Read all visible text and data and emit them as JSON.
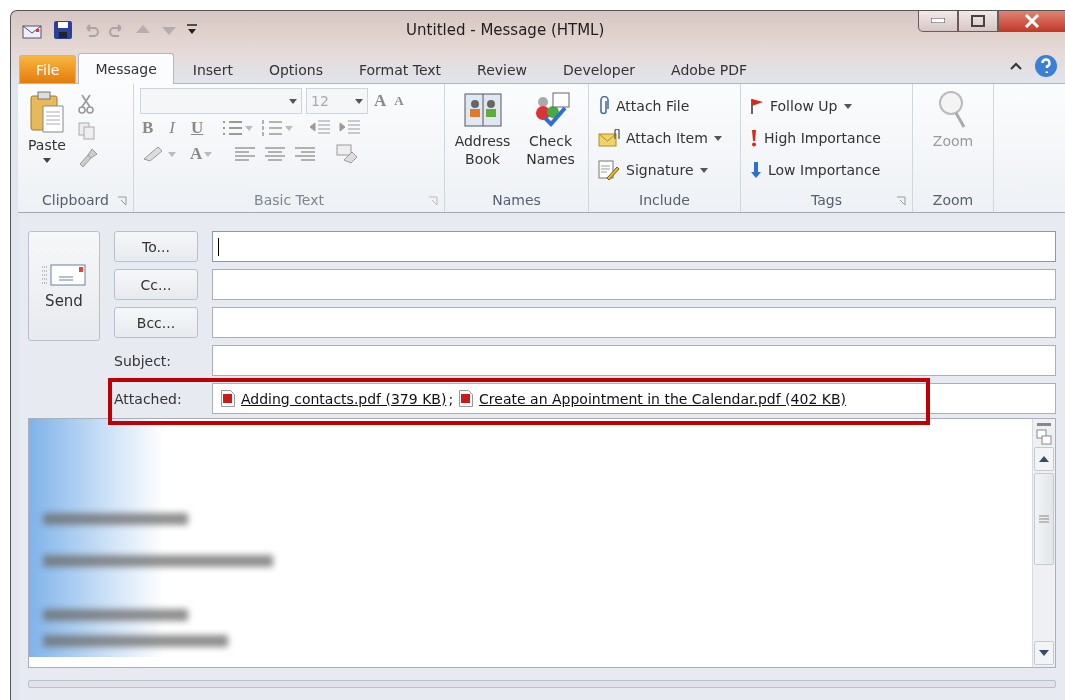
{
  "window": {
    "title": "Untitled  -  Message (HTML)"
  },
  "tabs": [
    {
      "label": "File",
      "kind": "file",
      "selected": false
    },
    {
      "label": "Message",
      "kind": "tab",
      "selected": true
    },
    {
      "label": "Insert",
      "kind": "tab",
      "selected": false
    },
    {
      "label": "Options",
      "kind": "tab",
      "selected": false
    },
    {
      "label": "Format Text",
      "kind": "tab",
      "selected": false
    },
    {
      "label": "Review",
      "kind": "tab",
      "selected": false
    },
    {
      "label": "Developer",
      "kind": "tab",
      "selected": false
    },
    {
      "label": "Adobe PDF",
      "kind": "tab",
      "selected": false
    }
  ],
  "ribbon": {
    "clipboard": {
      "label": "Clipboard",
      "paste": "Paste"
    },
    "basic_text": {
      "label": "Basic Text",
      "disabled": true,
      "font_size": "12",
      "grow_font": "A",
      "shrink_font": "A",
      "bold": "B",
      "italic": "I",
      "underline": "U",
      "font_color": "A"
    },
    "names": {
      "label": "Names",
      "buttons": [
        "Address Book",
        "Check Names"
      ]
    },
    "include": {
      "label": "Include",
      "items": [
        {
          "label": "Attach File",
          "dropdown": false
        },
        {
          "label": "Attach Item",
          "dropdown": true
        },
        {
          "label": "Signature",
          "dropdown": true
        }
      ]
    },
    "tags": {
      "label": "Tags",
      "items": [
        {
          "label": "Follow Up",
          "dropdown": true
        },
        {
          "label": "High Importance",
          "dropdown": false
        },
        {
          "label": "Low Importance",
          "dropdown": false
        }
      ]
    },
    "zoom": {
      "label": "Zoom",
      "button": "Zoom",
      "disabled": true
    }
  },
  "form": {
    "send": "Send",
    "recipients": [
      {
        "button": "To...",
        "focused": true
      },
      {
        "button": "Cc...",
        "focused": false
      },
      {
        "button": "Bcc...",
        "focused": false
      }
    ],
    "subject_label": "Subject:",
    "attached": {
      "label": "Attached:",
      "highlighted": true,
      "separator": ";",
      "files": [
        {
          "name": "Adding contacts.pdf (379 KB)"
        },
        {
          "name": "Create an Appointment in the Calendar.pdf (402 KB)"
        }
      ]
    }
  }
}
